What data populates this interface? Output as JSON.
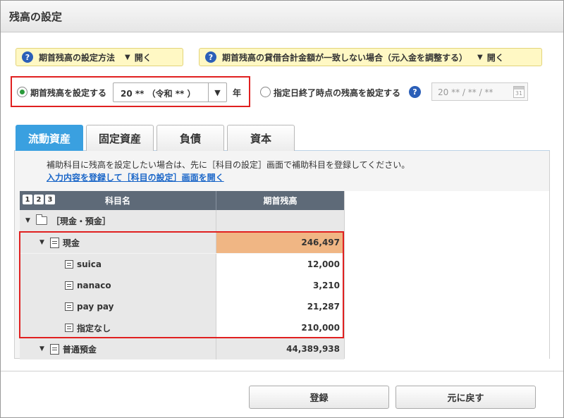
{
  "window": {
    "title": "残高の設定"
  },
  "help": {
    "settings_method": "期首残高の設定方法",
    "mismatch": "期首残高の貸借合計金額が一致しない場合（元入金を調整する）",
    "open_label": "開く"
  },
  "options": {
    "set_opening_label": "期首残高を設定する",
    "year_select_value": "20 ** （令和 ** ）",
    "year_suffix": "年",
    "set_by_date_label": "指定日終了時点の残高を設定する",
    "date_value": "20 ** / ** / **",
    "calendar_text": "31"
  },
  "tabs": [
    {
      "label": "流動資産",
      "active": true
    },
    {
      "label": "固定資産",
      "active": false
    },
    {
      "label": "負債",
      "active": false
    },
    {
      "label": "資本",
      "active": false
    }
  ],
  "notice": {
    "text": "補助科目に残高を設定したい場合は、先に［科目の設定］画面で補助科目を登録してください。",
    "link": "入力内容を登録して［科目の設定］画面を開く"
  },
  "grid": {
    "levels": [
      "1",
      "2",
      "3"
    ],
    "col_name": "科目名",
    "col_amount": "期首残高",
    "rows": [
      {
        "name": "［現金・預金］",
        "amount": ""
      },
      {
        "name": "現金",
        "amount": "246,497"
      },
      {
        "name": "suica",
        "amount": "12,000"
      },
      {
        "name": "nanaco",
        "amount": "3,210"
      },
      {
        "name": "pay pay",
        "amount": "21,287"
      },
      {
        "name": "指定なし",
        "amount": "210,000"
      },
      {
        "name": "普通預金",
        "amount": "44,389,938"
      }
    ]
  },
  "footer": {
    "register": "登録",
    "back": "元に戻す"
  },
  "colors": {
    "active_tab": "#3aa0e0",
    "highlight": "#f0b684",
    "annotation": "#e02020"
  }
}
